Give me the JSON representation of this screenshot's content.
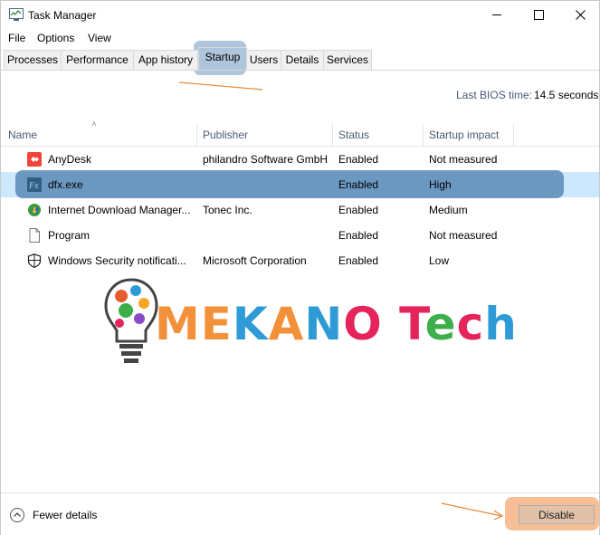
{
  "window": {
    "title": "Task Manager"
  },
  "menu": [
    "File",
    "Options",
    "View"
  ],
  "tabs": [
    "Processes",
    "Performance",
    "App history",
    "Startup",
    "Users",
    "Details",
    "Services"
  ],
  "active_tab": "Startup",
  "bios": {
    "label": "Last BIOS time:",
    "value": "14.5 seconds"
  },
  "columns": {
    "name": "Name",
    "publisher": "Publisher",
    "status": "Status",
    "impact": "Startup impact"
  },
  "rows": [
    {
      "name": "AnyDesk",
      "publisher": "philandro Software GmbH",
      "status": "Enabled",
      "impact": "Not measured",
      "icon": "anydesk-icon"
    },
    {
      "name": "dfx.exe",
      "publisher": "",
      "status": "Enabled",
      "impact": "High",
      "icon": "fx-icon"
    },
    {
      "name": "Internet Download Manager...",
      "publisher": "Tonec Inc.",
      "status": "Enabled",
      "impact": "Medium",
      "icon": "idm-icon"
    },
    {
      "name": "Program",
      "publisher": "",
      "status": "Enabled",
      "impact": "Not measured",
      "icon": "blank-file-icon"
    },
    {
      "name": "Windows Security notificati...",
      "publisher": "Microsoft Corporation",
      "status": "Enabled",
      "impact": "Low",
      "icon": "shield-icon"
    }
  ],
  "selected_row": 1,
  "watermark": {
    "text": "MEKANO Tech",
    "letters": [
      "M",
      "E",
      "K",
      "A",
      "N",
      "O",
      " ",
      "T",
      "e",
      "c",
      "h"
    ]
  },
  "footer": {
    "fewer_details": "Fewer details",
    "disable": "Disable"
  },
  "colors": {
    "highlight_blue": "#5082af",
    "highlight_orange": "#f5b482",
    "selection": "#cce8ff",
    "header_text": "#4a5a74"
  }
}
